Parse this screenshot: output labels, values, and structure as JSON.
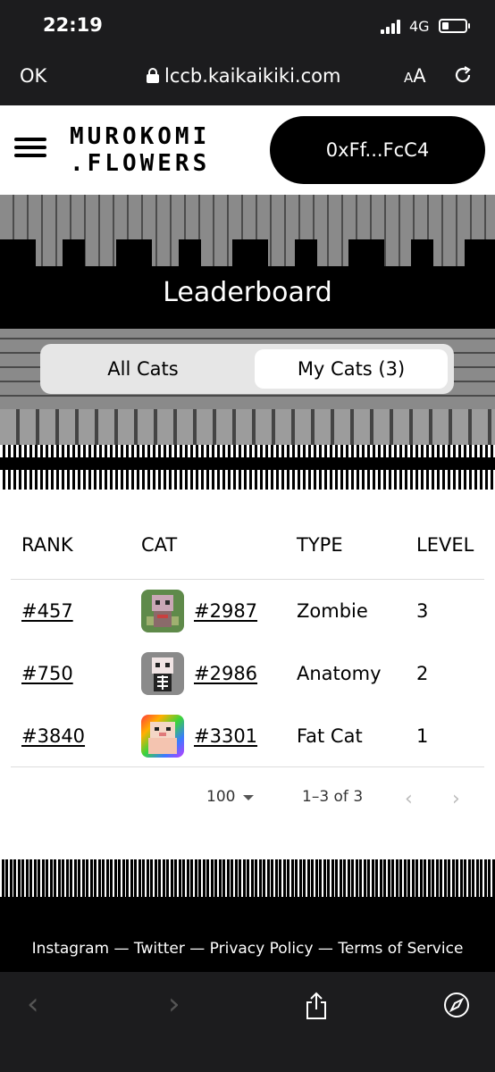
{
  "status": {
    "time": "22:19",
    "network": "4G"
  },
  "browser": {
    "done_label": "OK",
    "url": "lccb.kaikaikiki.com",
    "text_size_label_small": "A",
    "text_size_label_large": "A"
  },
  "header": {
    "logo_line1": "MUROKOMI",
    "logo_line2": ".FLOWERS",
    "wallet": "0xFf...FcC4"
  },
  "hero": {
    "title": "Leaderboard",
    "tabs": {
      "all": "All Cats",
      "mine": "My Cats (3)"
    }
  },
  "table": {
    "headers": {
      "rank": "RANK",
      "cat": "CAT",
      "type": "TYPE",
      "level": "LEVEL"
    },
    "rows": [
      {
        "rank": "#457",
        "cat": "#2987",
        "type": "Zombie",
        "level": "3"
      },
      {
        "rank": "#750",
        "cat": "#2986",
        "type": "Anatomy",
        "level": "2"
      },
      {
        "rank": "#3840",
        "cat": "#3301",
        "type": "Fat Cat",
        "level": "1"
      }
    ],
    "pager": {
      "page_size": "100",
      "range": "1–3 of 3"
    }
  },
  "footer": {
    "links": "Instagram — Twitter — Privacy Policy — Terms of Service"
  },
  "colors": {
    "accent": "#000000",
    "chrome": "#1c1c1e",
    "toggle_bg": "#e6e6e6"
  }
}
